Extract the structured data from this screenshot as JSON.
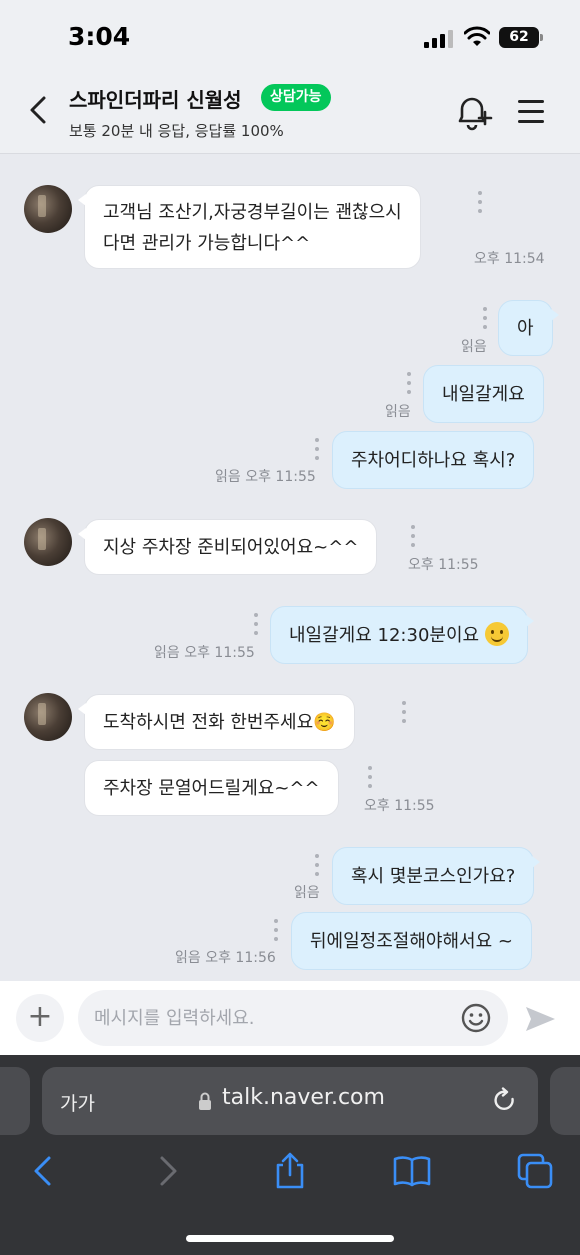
{
  "status_bar": {
    "time": "3:04",
    "battery": "62"
  },
  "header": {
    "shop_name": "스파인더파리 신월성",
    "badge": "상담가능",
    "response_info": "보통 20분 내 응답, 응답률 100%"
  },
  "messages": [
    {
      "text_line1": "고객님 조산기,자궁경부길이는 괜찮으시",
      "text_line2": "다면 관리가 가능합니다^^",
      "time": "오후 11:54"
    },
    {
      "text": "아",
      "status": "읽음"
    },
    {
      "text": "내일갈게요",
      "status": "읽음"
    },
    {
      "text": "주차어디하나요 혹시?",
      "status": "읽음 오후 11:55"
    },
    {
      "text": "지상 주차장 준비되어있어요~^^",
      "time": "오후 11:55"
    },
    {
      "text": "내일갈게요 12:30분이요",
      "status": "읽음 오후 11:55"
    },
    {
      "text": "도착하시면 전화 한번주세요☺️"
    },
    {
      "text": "주차장 문열어드릴게요~^^",
      "time": "오후 11:55"
    },
    {
      "text": "혹시 몇분코스인가요?",
      "status": "읽음"
    },
    {
      "text": "뒤에일정조절해야해서요 ~",
      "status": "읽음 오후 11:56"
    }
  ],
  "input": {
    "placeholder": "메시지를 입력하세요."
  },
  "browser": {
    "text_size": "가가",
    "url": "talk.naver.com"
  },
  "icons": {
    "back": "chevron-left-icon",
    "bell": "bell-plus-icon",
    "menu": "hamburger-icon",
    "plus": "plus-icon",
    "emoji": "smiley-icon",
    "send": "send-icon",
    "lock": "lock-icon",
    "reload": "reload-icon",
    "toolbar": [
      "back-arrow-icon",
      "forward-arrow-icon",
      "share-icon",
      "bookmarks-icon",
      "tabs-icon"
    ]
  },
  "colors": {
    "badge": "#03c75a",
    "outgoing_bubble": "#dcf0fd",
    "incoming_bubble": "#ffffff",
    "safari_accent": "#3a8ef6"
  }
}
